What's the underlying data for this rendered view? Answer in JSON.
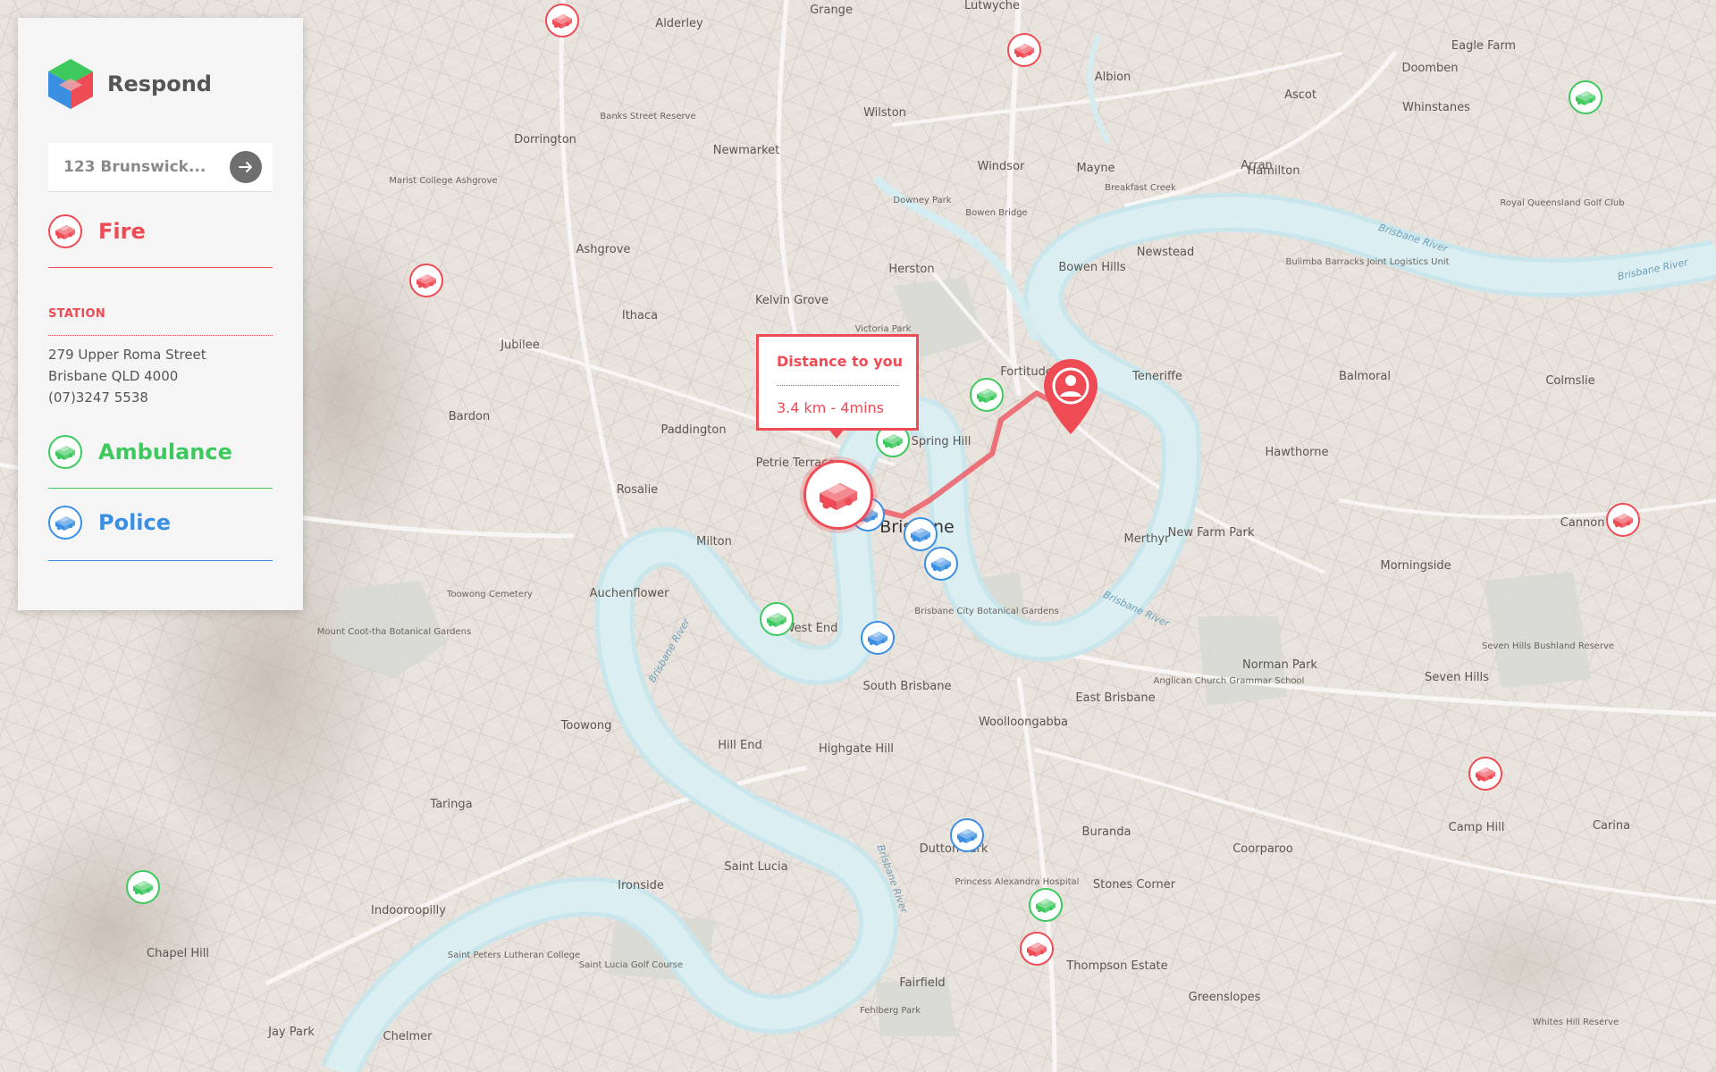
{
  "app": {
    "name": "Respond"
  },
  "search": {
    "placeholder": "123 Brunswick..."
  },
  "categories": {
    "fire": {
      "label": "Fire",
      "color": "#ee4b55"
    },
    "ambulance": {
      "label": "Ambulance",
      "color": "#3ec95e"
    },
    "police": {
      "label": "Police",
      "color": "#3b8fe2"
    }
  },
  "station": {
    "heading": "STATION",
    "address_line1": "279 Upper Roma Street",
    "address_line2": "Brisbane QLD 4000",
    "phone": "(07)3247 5538"
  },
  "tooltip": {
    "title": "Distance to you",
    "value": "3.4 km - 4mins"
  },
  "icons": {
    "vehicle": "vehicle-icon",
    "user": "user-location-icon",
    "arrow": "arrow-right-icon",
    "logo": "cube-logo-icon"
  },
  "map_labels": [
    "Alderley",
    "Grange",
    "Lutwyche",
    "Wilston",
    "Windsor",
    "Albion",
    "Ascot",
    "Hamilton",
    "Doomben",
    "Eagle Farm",
    "Dorrington",
    "Newmarket",
    "Herston",
    "Bowen Hills",
    "Newstead",
    "Kelvin Grove",
    "Ashgrove",
    "Ithaca",
    "Jubilee",
    "Bardon",
    "Paddington",
    "Rosalie",
    "Milton",
    "Auchenflower",
    "Toowong",
    "Petrie Terrace",
    "Spring Hill",
    "Fortitude Valley",
    "Teneriffe",
    "Balmoral",
    "Colmslie",
    "Hawthorne",
    "Morningside",
    "Merthyr",
    "New Farm Park",
    "Brisbane",
    "West End",
    "South Brisbane",
    "Highgate Hill",
    "Hill End",
    "Woolloongabba",
    "East Brisbane",
    "Norman Park",
    "Seven Hills",
    "Camp Hill",
    "Carina",
    "Coorparoo",
    "Buranda",
    "Stones Corner",
    "Dutton Park",
    "Saint Lucia",
    "Ironside",
    "Taringa",
    "Indooroopilly",
    "Chapel Hill",
    "Jay Park",
    "Chelmer",
    "Fairfield",
    "Greenslopes",
    "Thompson Estate",
    "Mayne",
    "Breakfast Creek",
    "Herston",
    "Arran",
    "Whinstanes",
    "Doomben",
    "Downey Park",
    "Bowen Bridge",
    "Mount Coot-tha Botanical Gardens",
    "Toowong Cemetery",
    "Brisbane City Botanical Gardens",
    "Banks Street Reserve",
    "Marist College Ashgrove",
    "Royal Queensland Golf Club",
    "Bulimba Barracks Joint Logistics Unit",
    "Seven Hills Bushland Reserve",
    "Anglican Church Grammar School",
    "Princess Alexandra Hospital",
    "Saint Lucia Golf Course",
    "Saint Peters Lutheran College",
    "Whites Hill Reserve",
    "Fehlberg Park",
    "Victoria Park",
    "Brisbane River",
    "Camp Hill",
    "Cannon Hill"
  ]
}
